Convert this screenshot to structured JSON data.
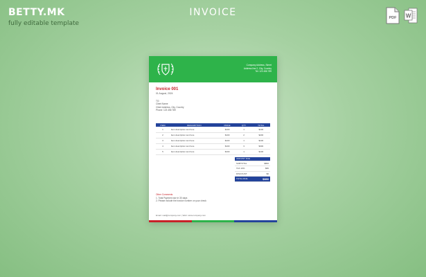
{
  "brand": {
    "name": "BETTY.MK",
    "tagline": "fully editable template"
  },
  "page_title": "INVOICE",
  "file_formats": {
    "pdf_label": "PDF",
    "word_label": "W"
  },
  "colors": {
    "header_green": "#2eb34a",
    "accent_red": "#c72128",
    "table_blue": "#23439b"
  },
  "document": {
    "header_info": [
      "Company Address, Street",
      "Address line 2, City, Country",
      "Tel: 123 456 789"
    ],
    "invoice_title": "Invoice 001",
    "invoice_date": "01 August, 2024",
    "to_label": "TO:",
    "to_lines": [
      "Client Name",
      "Client Address, City, Country",
      "Phone: 123 456 789"
    ],
    "table": {
      "headers": [
        "ITEM",
        "DESCRIPTION",
        "PRICE",
        "QTY",
        "TOTAL"
      ],
      "rows": [
        [
          "1",
          "Item description text here",
          "$100",
          "1",
          "$100"
        ],
        [
          "2",
          "Item description text here",
          "$100",
          "2",
          "$200"
        ],
        [
          "3",
          "Item description text here",
          "$100",
          "1",
          "$100"
        ],
        [
          "4",
          "Item description text here",
          "$100",
          "3",
          "$300"
        ],
        [
          "5",
          "Item description text here",
          "$100",
          "1",
          "$100"
        ]
      ]
    },
    "totals": {
      "header": "AMOUNT DUE",
      "subtotal_label": "SUBTOTAL",
      "subtotal_value": "$800",
      "tax_label": "TAX 10%",
      "tax_value": "$80",
      "discount_label": "DISCOUNT",
      "discount_value": "$0",
      "total_label": "TOTAL DUE",
      "total_value": "$880"
    },
    "notes": {
      "title": "Other Comments",
      "lines": [
        "1. Total Payment due in 30 days",
        "2. Please include the invoice number on your check"
      ]
    },
    "footer_text": "Email: mail@company.com  |  Web: www.company.com",
    "footer_colors": [
      "#c72128",
      "#2eb34a",
      "#23439b"
    ]
  }
}
